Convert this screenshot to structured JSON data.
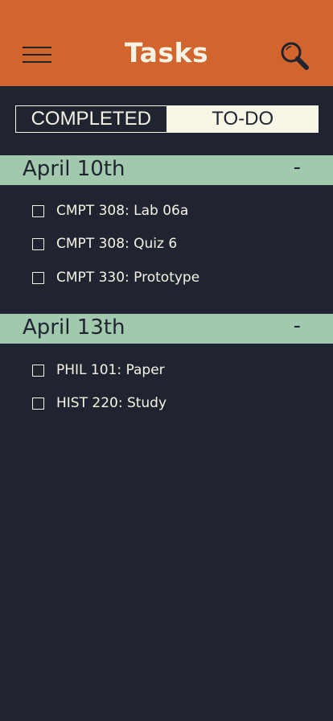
{
  "header": {
    "title": "Tasks",
    "menu_icon": "hamburger-menu-icon",
    "search_icon": "search-icon",
    "background_color": "#d2642d"
  },
  "tabs": [
    {
      "label": "COMPLETED",
      "selected": false
    },
    {
      "label": "TO-DO",
      "selected": true
    }
  ],
  "sections": [
    {
      "date": "April 10th",
      "collapse_label": "-",
      "tasks": [
        {
          "label": "CMPT 308: Lab 06a",
          "checked": false
        },
        {
          "label": "CMPT 308: Quiz 6",
          "checked": false
        },
        {
          "label": "CMPT 330: Prototype",
          "checked": false
        }
      ]
    },
    {
      "date": "April 13th",
      "collapse_label": "-",
      "tasks": [
        {
          "label": "PHIL 101: Paper",
          "checked": false
        },
        {
          "label": "HIST 220: Study",
          "checked": false
        }
      ]
    }
  ],
  "colors": {
    "background": "#1f2430",
    "section_header": "#a2c9ae",
    "text_light": "#f6f3e4"
  }
}
